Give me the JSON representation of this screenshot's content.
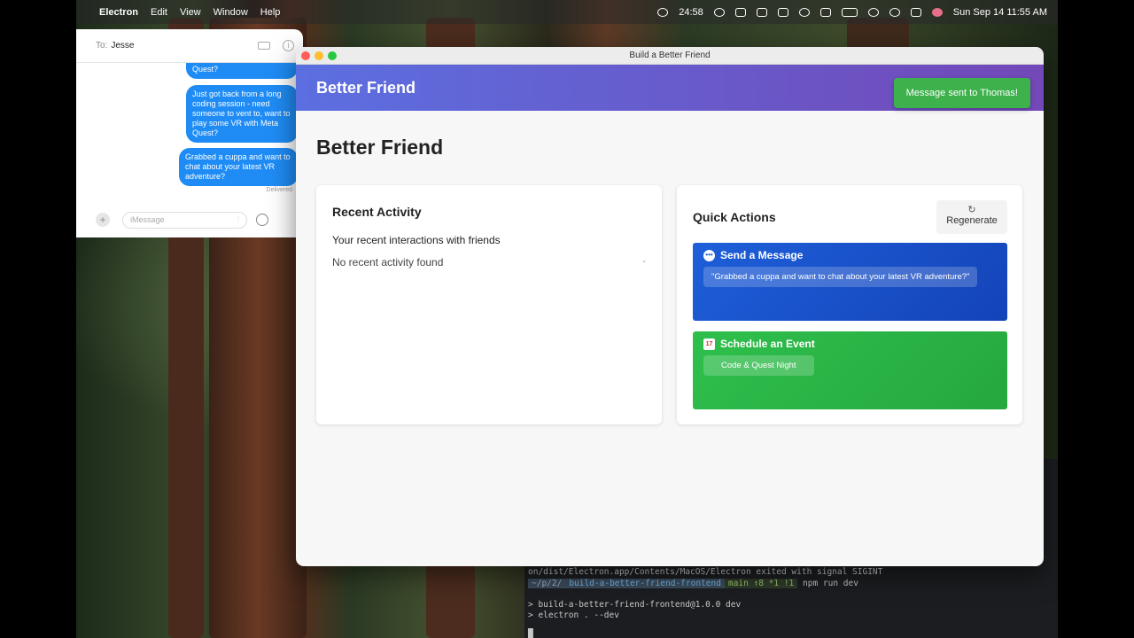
{
  "menubar": {
    "app_name": "Electron",
    "menus": [
      "Edit",
      "View",
      "Window",
      "Help"
    ],
    "timer": "24:58",
    "datetime": "Sun Sep 14  11:55 AM"
  },
  "messages": {
    "to_label": "To:",
    "recipient": "Jesse",
    "bubbles": [
      "Quest?",
      "Just got back from a long coding session - need someone to vent to, want to play some VR with Meta Quest?",
      "Grabbed a cuppa and want to chat about your latest VR adventure?"
    ],
    "delivered": "Delivered",
    "input_placeholder": "iMessage"
  },
  "terminal": {
    "line1": "on/dist/Electron.app/Contents/MacOS/Electron exited with signal SIGINT",
    "prompt_dir": "~/p/2/",
    "prompt_project": "build-a-better-friend-frontend",
    "prompt_branch": "main ↑8 *1 !1",
    "command": "npm run dev",
    "line3": "> build-a-better-friend-frontend@1.0.0 dev",
    "line4": "> electron . --dev",
    "cursor": "█"
  },
  "app": {
    "window_title": "Build a Better Friend",
    "brand": "Better Friend",
    "toast": "Message sent to Thomas!",
    "page_title": "Better Friend",
    "recent": {
      "title": "Recent Activity",
      "subtitle": "Your recent interactions with friends",
      "empty": "No recent activity found",
      "dash": "-"
    },
    "quick": {
      "title": "Quick Actions",
      "regenerate": "Regenerate",
      "send_message": {
        "title": "Send a Message",
        "text": "\"Grabbed a cuppa and want to chat about your latest VR adventure?\""
      },
      "schedule_event": {
        "title": "Schedule an Event",
        "text": "Code & Quest Night"
      }
    }
  },
  "colors": {
    "header_start": "#5c6fe0",
    "header_end": "#7348b8",
    "message_blue": "#1e5fd9",
    "event_green": "#2fbf4d",
    "toast_green": "#3db14b",
    "imessage_blue": "#1f8cf5"
  }
}
